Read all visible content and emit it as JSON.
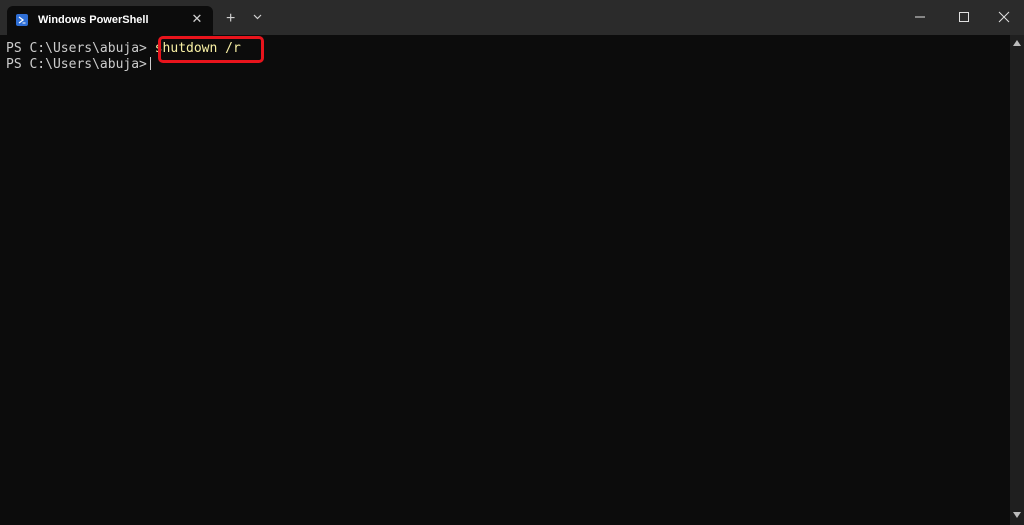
{
  "window": {
    "tab_title": "Windows PowerShell",
    "tab_icon": "powershell-icon",
    "new_tab_symbol": "+",
    "dropdown_symbol": "⌄",
    "close_tab_symbol": "✕"
  },
  "terminal": {
    "lines": [
      {
        "prompt": "PS C:\\Users\\abuja>",
        "command": "shutdown /r"
      },
      {
        "prompt": "PS C:\\Users\\abuja>",
        "command": ""
      }
    ]
  },
  "annotation": {
    "highlight_color": "#e8141c",
    "target": "shutdown /r"
  }
}
